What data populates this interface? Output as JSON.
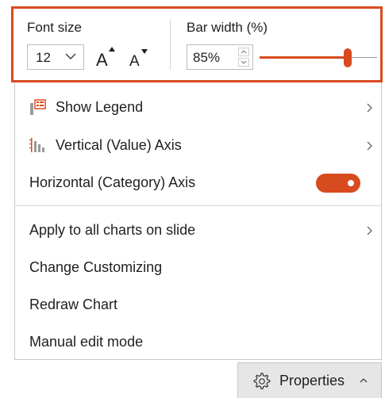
{
  "toolbar": {
    "font_size_label": "Font size",
    "font_size_value": "12",
    "grow_font_icon": "increase-font-size-icon",
    "shrink_font_icon": "decrease-font-size-icon",
    "bar_width_label": "Bar width (%)",
    "bar_width_value": "85%",
    "bar_width_slider_level": 0.75,
    "highlight_color": "#d84b1f"
  },
  "menu": {
    "items": [
      {
        "label": "Show Legend",
        "icon": "legend-icon",
        "submenu": true
      },
      {
        "label": "Vertical (Value) Axis",
        "icon": "vertical-axis-icon",
        "submenu": true
      },
      {
        "label": "Horizontal (Category) Axis",
        "toggle_on": true
      },
      {
        "label": "Apply to all charts on slide",
        "submenu": true
      },
      {
        "label": "Change Customizing"
      },
      {
        "label": "Redraw Chart"
      },
      {
        "label": "Manual edit mode"
      }
    ]
  },
  "properties_button": {
    "label": "Properties",
    "icon": "gear-icon"
  },
  "colors": {
    "accent": "#d84b1f",
    "panel_border": "#c8c8c8",
    "properties_bg": "#e6e6e6"
  }
}
